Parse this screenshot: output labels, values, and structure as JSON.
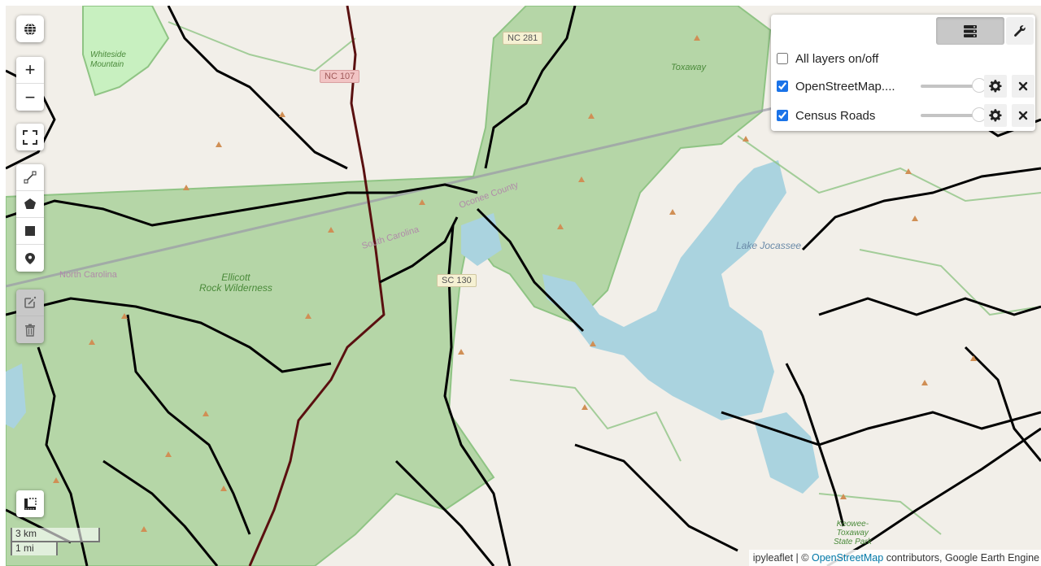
{
  "map": {
    "labels": {
      "whiteside": "Whiteside\nMountain",
      "whiteside_line1": "Whiteside",
      "whiteside_line2": "Mountain",
      "nc107": "NC 107",
      "nc281": "NC 281",
      "toxaway": "Toxaway",
      "oconee_county": "Oconee County",
      "south_carolina": "South Carolina",
      "north_carolina": "North Carolina",
      "ellicott_line1": "Ellicott",
      "ellicott_line2": "Rock Wilderness",
      "sc130": "SC 130",
      "lake_jocassee": "Lake Jocassee",
      "keowee_line1": "Keowee-",
      "keowee_line2": "Toxaway",
      "keowee_line3": "State Park"
    },
    "colors": {
      "land": "#f2efe9",
      "forest": "#add19e",
      "water": "#aad3df",
      "roads": "#000000",
      "peak": "#d08f55",
      "boundary": "#8fc484"
    }
  },
  "controls": {
    "basemap_icon": "globe-icon",
    "zoom_in": "+",
    "zoom_out": "−",
    "fullscreen_icon": "fullscreen-icon",
    "draw_tools": [
      "draw-polyline-icon",
      "draw-polygon-icon",
      "draw-rectangle-icon",
      "draw-marker-icon"
    ],
    "edit_tools": [
      "edit-layers-icon",
      "delete-layers-icon"
    ],
    "measure_icon": "measure-icon"
  },
  "layers_panel": {
    "layers_button_icon": "layers-icon",
    "wrench_button_icon": "wrench-icon",
    "all_layers_label": "All layers on/off",
    "all_layers_checked": false,
    "layers": [
      {
        "name": "OpenStreetMap....",
        "checked": true,
        "opacity": 1.0
      },
      {
        "name": "Census Roads",
        "checked": true,
        "opacity": 1.0
      }
    ]
  },
  "scale": {
    "metric": "3 km",
    "imperial": "1 mi"
  },
  "attribution": {
    "prefix": "ipyleaflet | © ",
    "link": "OpenStreetMap",
    "suffix": " contributors, Google Earth Engine"
  }
}
